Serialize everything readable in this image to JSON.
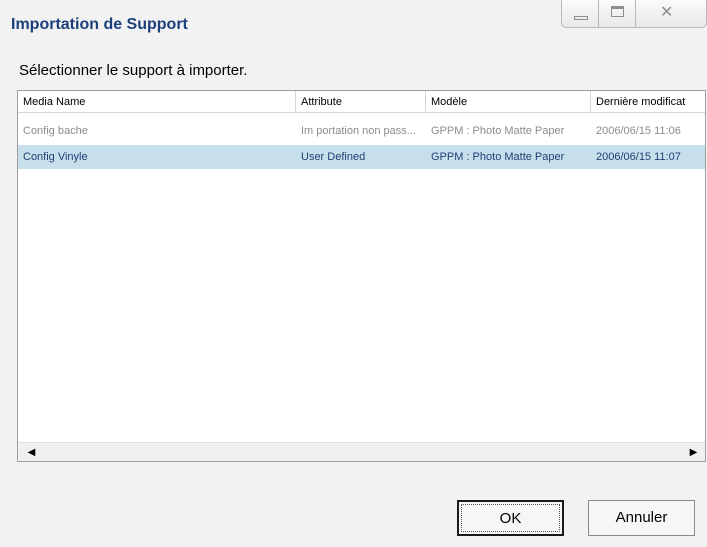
{
  "window": {
    "title": "Importation de Support",
    "controls": [
      "minimize",
      "maximize",
      "close"
    ],
    "close_glyph": "✕"
  },
  "instruction": "Sélectionner le support à importer.",
  "table": {
    "columns": [
      "Media Name",
      "Attribute",
      "Modèle",
      "Dernière modificat"
    ],
    "rows": [
      {
        "media_name": "Config bache",
        "attribute": "Im portation non pass...",
        "model": "GPPM : Photo Matte Paper",
        "modified": "2006/06/15 11:06",
        "state": "disabled"
      },
      {
        "media_name": "Config Vinyle",
        "attribute": "User Defined",
        "model": "GPPM : Photo Matte Paper",
        "modified": "2006/06/15 11:07",
        "state": "selected"
      }
    ],
    "scroll_left_glyph": "◀",
    "scroll_right_glyph": "▶"
  },
  "buttons": {
    "ok_label": "OK",
    "cancel_label": "Annuler"
  },
  "colors": {
    "title": "#1b3f7a",
    "selected_row_bg": "#c7dfeb",
    "selected_row_text": "#1d3f76",
    "disabled_row_text": "#8c8c8c"
  }
}
